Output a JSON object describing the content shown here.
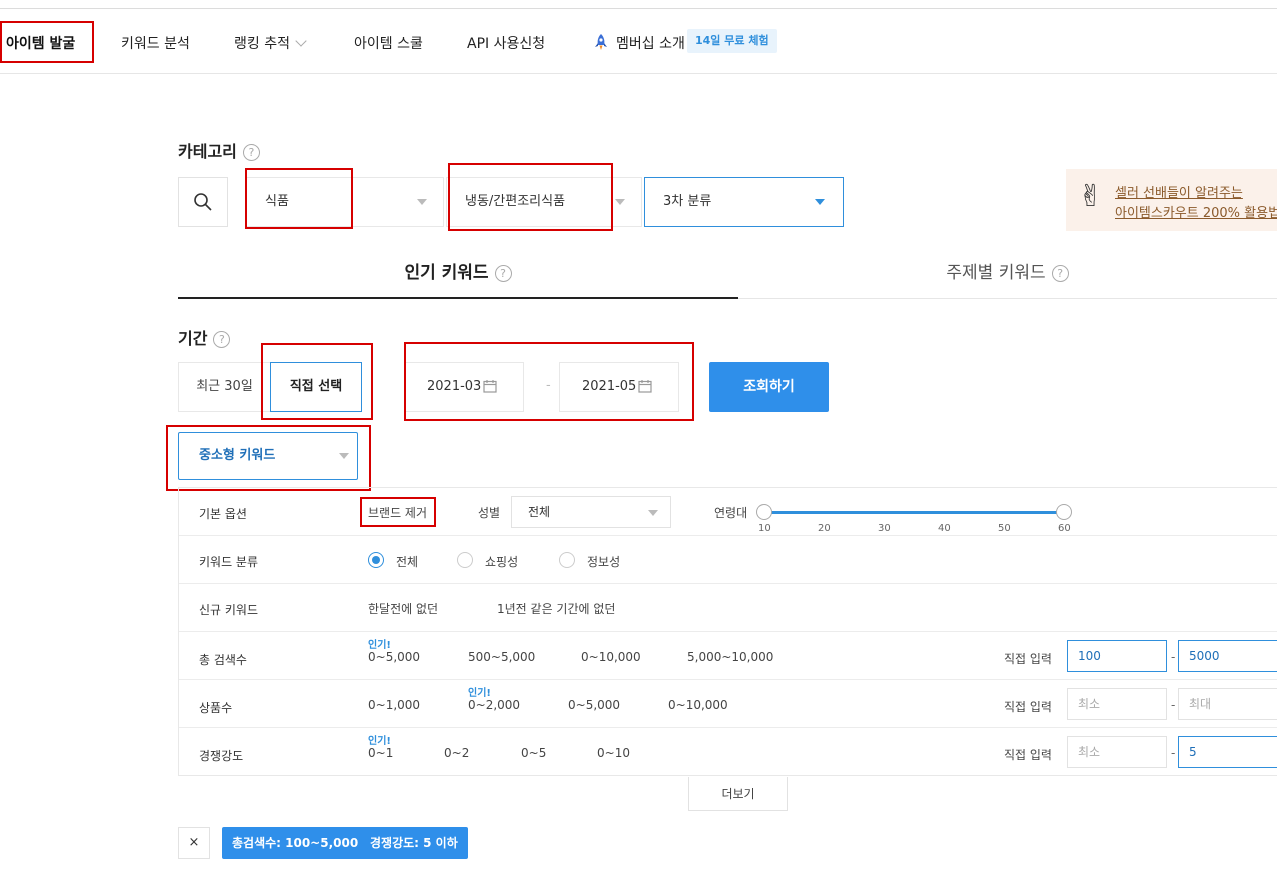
{
  "nav": {
    "items": [
      {
        "label": "아이템 발굴",
        "active": true
      },
      {
        "label": "키워드 분석"
      },
      {
        "label": "랭킹 추적"
      },
      {
        "label": "아이템 스쿨"
      },
      {
        "label": "API 사용신청"
      },
      {
        "label": "멤버십 소개"
      }
    ],
    "trial_badge": "14일 무료 체험"
  },
  "category": {
    "label": "카테고리",
    "help": "?",
    "level1": "식품",
    "level2": "냉동/간편조리식품",
    "level3": "3차 분류"
  },
  "promo": {
    "line1": "셀러 선배들이 알려주는",
    "line2": "아이템스카우트 200% 활용법"
  },
  "tabs": [
    {
      "label": "인기 키워드",
      "active": true
    },
    {
      "label": "주제별 키워드"
    }
  ],
  "period": {
    "label": "기간",
    "recent": "최근 30일",
    "custom": "직접 선택",
    "start": "2021-03",
    "end": "2021-05",
    "dash": "-",
    "submit": "조회하기"
  },
  "keyword_type": "중소형 키워드",
  "filters": {
    "basic": {
      "label": "기본 옵션",
      "brand_exclude": "브랜드 제거",
      "gender_label": "성별",
      "gender_value": "전체",
      "age_label": "연령대",
      "age_ticks": [
        "10",
        "20",
        "30",
        "40",
        "50",
        "60"
      ],
      "age_range": [
        10,
        60
      ]
    },
    "keyword_class": {
      "label": "키워드 분류",
      "options": [
        "전체",
        "쇼핑성",
        "정보성"
      ],
      "selected": "전체"
    },
    "new_keyword": {
      "label": "신규 키워드",
      "options": [
        "한달전에 없던",
        "1년전 같은 기간에 없던"
      ]
    },
    "total_search": {
      "label": "총 검색수",
      "hot": "인기!",
      "options": [
        "0~5,000",
        "500~5,000",
        "0~10,000",
        "5,000~10,000"
      ],
      "manual_label": "직접 입력",
      "min": "100",
      "max": "5000"
    },
    "product_count": {
      "label": "상품수",
      "hot": "인기!",
      "options": [
        "0~1,000",
        "0~2,000",
        "0~5,000",
        "0~10,000"
      ],
      "manual_label": "직접 입력",
      "min_placeholder": "최소",
      "max_placeholder": "최대"
    },
    "competition": {
      "label": "경쟁강도",
      "hot": "인기!",
      "options": [
        "0~1",
        "0~2",
        "0~5",
        "0~10"
      ],
      "manual_label": "직접 입력",
      "min_placeholder": "최소",
      "max": "5"
    },
    "range_dash": "-"
  },
  "more": "더보기",
  "applied": {
    "clear": "×",
    "chips": [
      "총검색수: 100~5,000",
      "경쟁강도: 5 이하"
    ]
  }
}
